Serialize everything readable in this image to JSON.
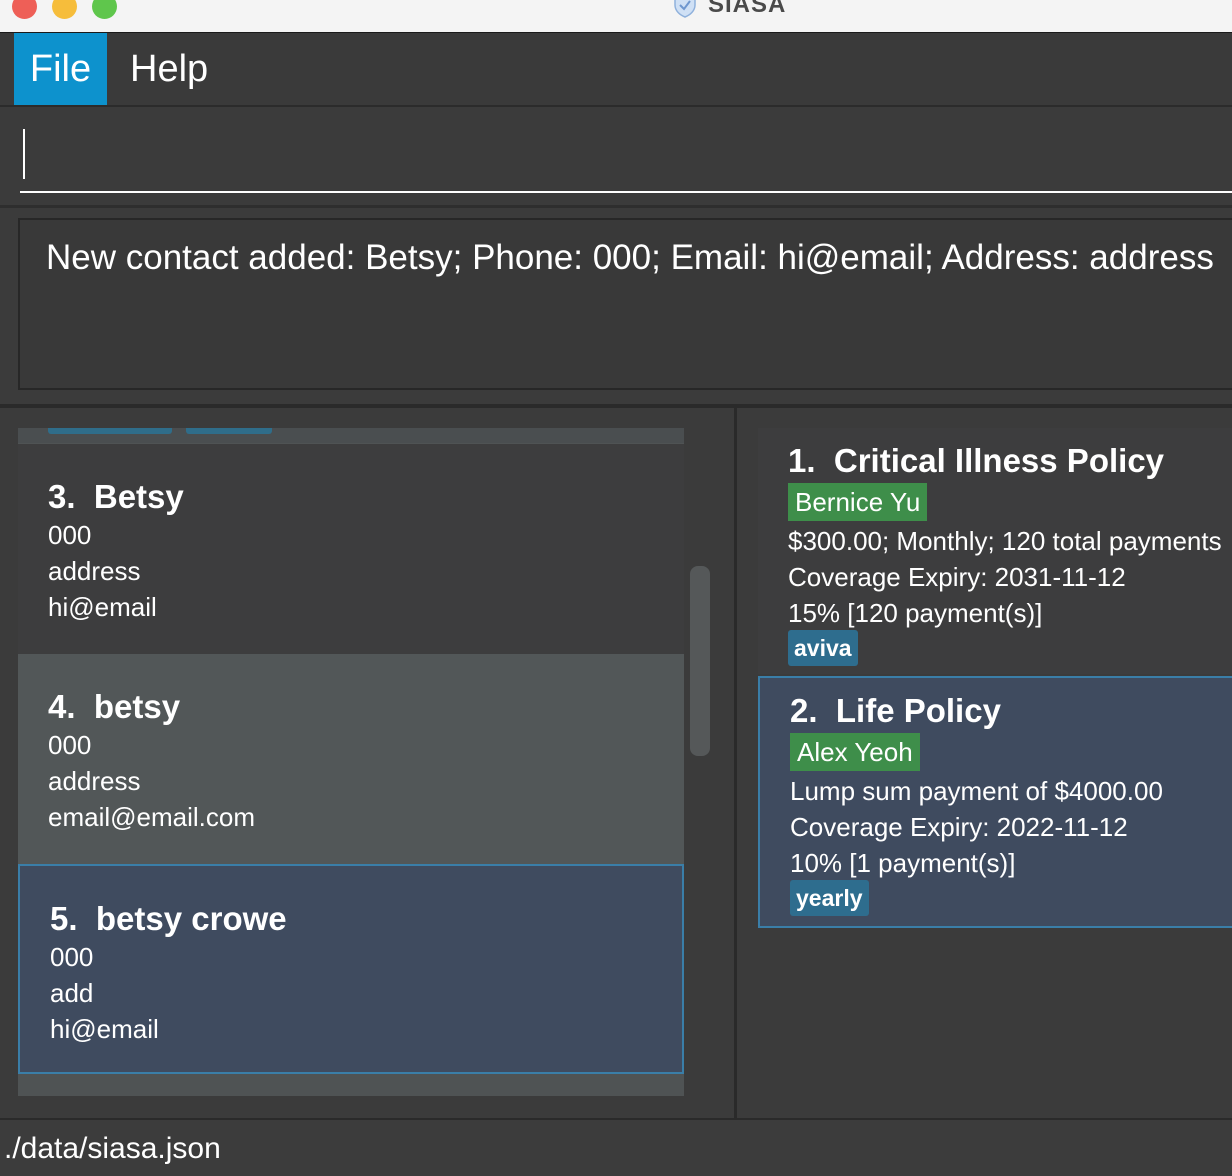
{
  "window": {
    "title": "SIASA",
    "title_icon": "shield-check-icon"
  },
  "menu": {
    "file_label": "File",
    "help_label": "Help"
  },
  "command": {
    "value": ""
  },
  "result": {
    "message": "New contact added: Betsy; Phone: 000; Email: hi@email; Address: address"
  },
  "contacts": [
    {
      "index": "3.",
      "name": "Betsy",
      "phone": "000",
      "address": "address",
      "email": "hi@email"
    },
    {
      "index": "4.",
      "name": "betsy",
      "phone": "000",
      "address": "address",
      "email": "email@email.com"
    },
    {
      "index": "5.",
      "name": "betsy crowe",
      "phone": "000",
      "address": "add",
      "email": "hi@email"
    }
  ],
  "policies": [
    {
      "index": "1.",
      "title": "Critical Illness Policy",
      "owner": "Bernice Yu",
      "payment": "$300.00; Monthly; 120 total payments",
      "expiry": "Coverage Expiry: 2031-11-12",
      "commission": "15% [120 payment(s)]",
      "tag": "aviva"
    },
    {
      "index": "2.",
      "title": "Life Policy",
      "owner": "Alex Yeoh",
      "payment": "Lump sum payment of $4000.00",
      "expiry": "Coverage Expiry: 2022-11-12",
      "commission": "10% [1 payment(s)]",
      "tag": "yearly"
    }
  ],
  "status": {
    "file_path": "./data/siasa.json"
  },
  "colors": {
    "menu_highlight": "#0d92cd",
    "owner_tag": "#3e8e4a",
    "policy_tag": "#2e6d8e",
    "selected_card": "#3f4b5f"
  }
}
